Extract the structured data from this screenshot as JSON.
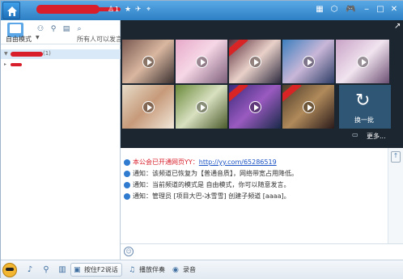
{
  "titlebar": {
    "home_icon": "home-icon",
    "member_count": "1",
    "icons": [
      "star-icon",
      "plane-icon",
      "satellite-icon"
    ],
    "right_icons": [
      "grid-icon",
      "nav-icon",
      "gamepad-icon",
      "minimize-icon",
      "maximize-icon",
      "close-icon"
    ]
  },
  "left": {
    "mode_label": "自由模式",
    "mode_note": "所有人可以发言",
    "channel_count": "(1)"
  },
  "grid": {
    "swap_label": "换一批",
    "more_label": "更多..."
  },
  "chat": {
    "messages": [
      {
        "prefix": "本公会已开通网页YY：",
        "link": "http://yy.com/65286519",
        "style": "red"
      },
      {
        "prefix": "通知：该频道已恢复为【普通音质】，网络带宽占用降低。",
        "link": "",
        "style": "normal"
      },
      {
        "prefix": "通知：当前频道的模式是 自由模式，你可以随意发言。",
        "link": "",
        "style": "normal"
      },
      {
        "prefix": "通知：管理员 [项目大巴-冰雪雪] 创建子频道 [aaaa]。",
        "link": "",
        "style": "normal"
      }
    ]
  },
  "toolbar": {
    "ptt_label": "按住F2说话",
    "music_label": "播放伴奏",
    "record_label": "录音"
  },
  "colors": {
    "accent": "#2d7fc4",
    "grid_bg": "#1c2630",
    "swap_tile": "#2f5675",
    "notice_red": "#d81e2a"
  }
}
